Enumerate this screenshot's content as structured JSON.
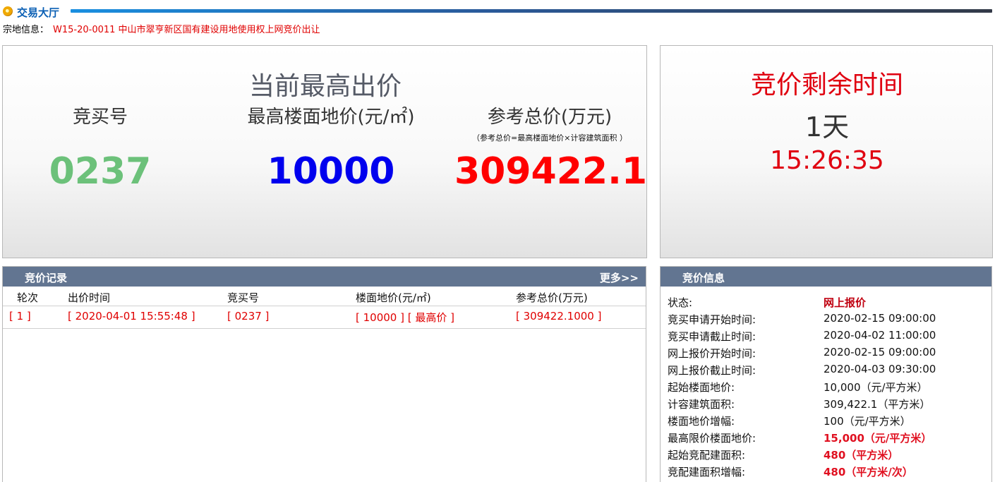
{
  "header": {
    "title": "交易大厅",
    "parcel_label": "宗地信息：",
    "parcel_value": "W15-20-0011 中山市翠亨新区国有建设用地使用权上网竞价出让"
  },
  "current_bid": {
    "heading": "当前最高出价",
    "bidder_label": "竞买号",
    "floor_price_label": "最高楼面地价(元/㎡)",
    "total_label": "参考总价(万元)",
    "total_note": "（参考总价=最高楼面地价×计容建筑面积 ）",
    "bidder_value": "0237",
    "floor_price_value": "10000",
    "total_value": "309422.1"
  },
  "countdown": {
    "heading": "竞价剩余时间",
    "days": "1天",
    "clock": "15:26:35"
  },
  "records": {
    "title": "竞价记录",
    "more": "更多>>",
    "columns": [
      "轮次",
      "出价时间",
      "竞买号",
      "楼面地价(元/㎡)",
      "参考总价(万元)"
    ],
    "rows": [
      {
        "round": "[ 1 ]",
        "time": "[ 2020-04-01 15:55:48 ]",
        "bidder": "[ 0237 ]",
        "price": "[ 10000 ] [ 最高价 ]",
        "total": "[ 309422.1000 ]"
      }
    ]
  },
  "info": {
    "title": "竞价信息",
    "items": [
      {
        "label": "状态:",
        "value": "网上报价"
      },
      {
        "label": "竞买申请开始时间:",
        "value": "2020-02-15 09:00:00"
      },
      {
        "label": "竞买申请截止时间:",
        "value": "2020-04-02 11:00:00"
      },
      {
        "label": "网上报价开始时间:",
        "value": "2020-02-15 09:00:00"
      },
      {
        "label": "网上报价截止时间:",
        "value": "2020-04-03 09:30:00"
      },
      {
        "label": "起始楼面地价:",
        "value": "10,000（元/平方米）"
      },
      {
        "label": "计容建筑面积:",
        "value": "309,422.1（平方米）"
      },
      {
        "label": "楼面地价增幅:",
        "value": "100（元/平方米）"
      },
      {
        "label": "最高限价楼面地价:",
        "value": "15,000（元/平方米）"
      },
      {
        "label": "起始竞配建面积:",
        "value": "480（平方米）"
      },
      {
        "label": "竞配建面积增幅:",
        "value": "480（平方米/次）"
      }
    ]
  },
  "colors": {
    "accent_blue": "#0a5fb4",
    "bar_bg": "#627591",
    "red": "#e00000",
    "green": "#6cc17a",
    "blue": "#0000ee"
  }
}
